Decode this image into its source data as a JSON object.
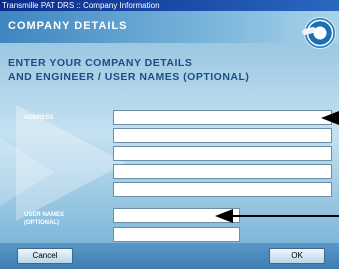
{
  "window": {
    "title": "Transmille PAT DRS :: Company Information"
  },
  "header": {
    "title": "COMPANY DETAILS"
  },
  "instructions": {
    "line1": "ENTER YOUR COMPANY DETAILS",
    "line2": "AND ENGINEER / USER NAMES (OPTIONAL)"
  },
  "address": {
    "label": "ADDRESS",
    "lines": [
      "",
      "",
      "",
      "",
      ""
    ]
  },
  "user_names": {
    "label_line1": "USER NAMES",
    "label_line2": "(OPTIONAL)",
    "names": [
      "",
      ""
    ]
  },
  "buttons": {
    "cancel": "Cancel",
    "ok": "OK"
  },
  "colors": {
    "title_blue": "#1a4f86",
    "background": "#8fc0dc",
    "titlebar": "#0a2a8a"
  }
}
